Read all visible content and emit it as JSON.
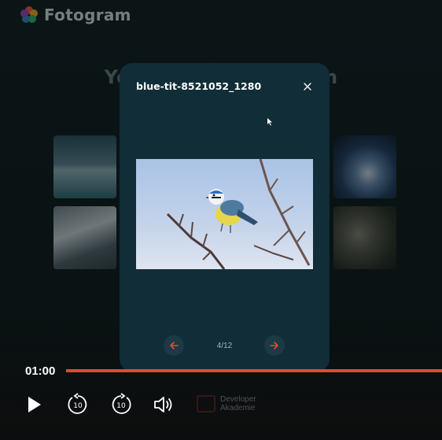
{
  "app": {
    "title": "Fotogram"
  },
  "background": {
    "heading": "Your Fotogram album"
  },
  "modal": {
    "title": "blue-tit-8521052_1280",
    "counter": "4/12"
  },
  "player": {
    "time": "01:00",
    "progress": 1.0
  },
  "brand": {
    "line1": "Developer",
    "line2": "Akademie"
  },
  "colors": {
    "accent": "#e2492f",
    "modal_bg": "#102d38"
  },
  "icons": [
    "fotogram-logo-icon",
    "close-icon",
    "arrow-left-icon",
    "arrow-right-icon",
    "play-icon",
    "rewind-10-icon",
    "forward-10-icon",
    "volume-icon",
    "cursor-icon"
  ]
}
